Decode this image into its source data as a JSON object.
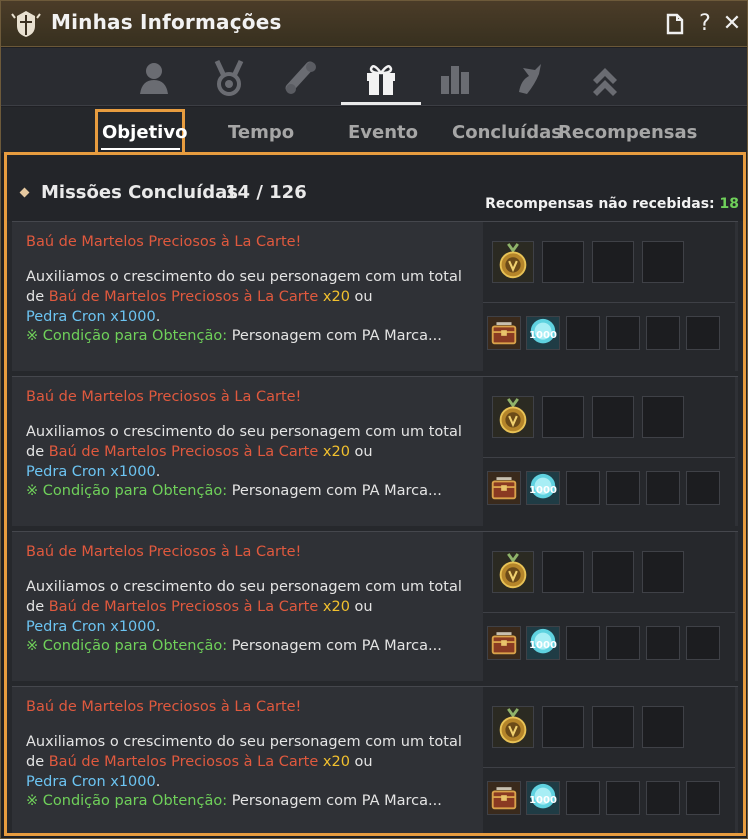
{
  "window": {
    "title": "Minhas Informações"
  },
  "title_buttons": {
    "doc": "▯",
    "help": "?",
    "close": "✕"
  },
  "category_icons": [
    "person-icon",
    "medal-icon",
    "scroll-icon",
    "gift-icon",
    "chart-icon",
    "dragon-icon",
    "rank-up-icon"
  ],
  "tabs": [
    "Objetivo",
    "Tempo",
    "Evento",
    "Concluídas",
    "Recompensas"
  ],
  "section": {
    "title": "Missões Concluídas",
    "count": "14 / 126",
    "unclaimed_label": "Recompensas não recebidas:",
    "unclaimed_count": "18"
  },
  "missions": [
    {
      "title": "Baú de Martelos Preciosos à La Carte!",
      "desc_pre": "Auxiliamos o crescimento do seu personagem com um total de ",
      "item_name": "Baú de Martelos Preciosos à La Carte",
      "item_qty": " x20",
      "desc_mid": " ou",
      "item2": "Pedra Cron x1000",
      "desc_end": ".",
      "cond_label": "※ Condição para Obtenção:",
      "cond_text": " Personagem com PA Marca...",
      "crystal_qty": "1000"
    },
    {
      "title": "Baú de Martelos Preciosos à La Carte!",
      "desc_pre": "Auxiliamos o crescimento do seu personagem com um total de ",
      "item_name": "Baú de Martelos Preciosos à La Carte",
      "item_qty": " x20",
      "desc_mid": " ou",
      "item2": "Pedra Cron x1000",
      "desc_end": ".",
      "cond_label": "※ Condição para Obtenção:",
      "cond_text": " Personagem com PA Marca...",
      "crystal_qty": "1000"
    },
    {
      "title": "Baú de Martelos Preciosos à La Carte!",
      "desc_pre": "Auxiliamos o crescimento do seu personagem com um total de ",
      "item_name": "Baú de Martelos Preciosos à La Carte",
      "item_qty": " x20",
      "desc_mid": " ou",
      "item2": "Pedra Cron x1000",
      "desc_end": ".",
      "cond_label": "※ Condição para Obtenção:",
      "cond_text": " Personagem com PA Marca...",
      "crystal_qty": "1000"
    },
    {
      "title": "Baú de Martelos Preciosos à La Carte!",
      "desc_pre": "Auxiliamos o crescimento do seu personagem com um total de ",
      "item_name": "Baú de Martelos Preciosos à La Carte",
      "item_qty": " x20",
      "desc_mid": " ou",
      "item2": "Pedra Cron x1000",
      "desc_end": ".",
      "cond_label": "※ Condição para Obtenção:",
      "cond_text": " Personagem com PA Marca...",
      "crystal_qty": "1000"
    }
  ],
  "colors": {
    "accent": "#e79c3f",
    "mission_title": "#e0593e",
    "quantity": "#f2c12e",
    "item_blue": "#6cc4f2",
    "condition_green": "#6fd05a"
  }
}
